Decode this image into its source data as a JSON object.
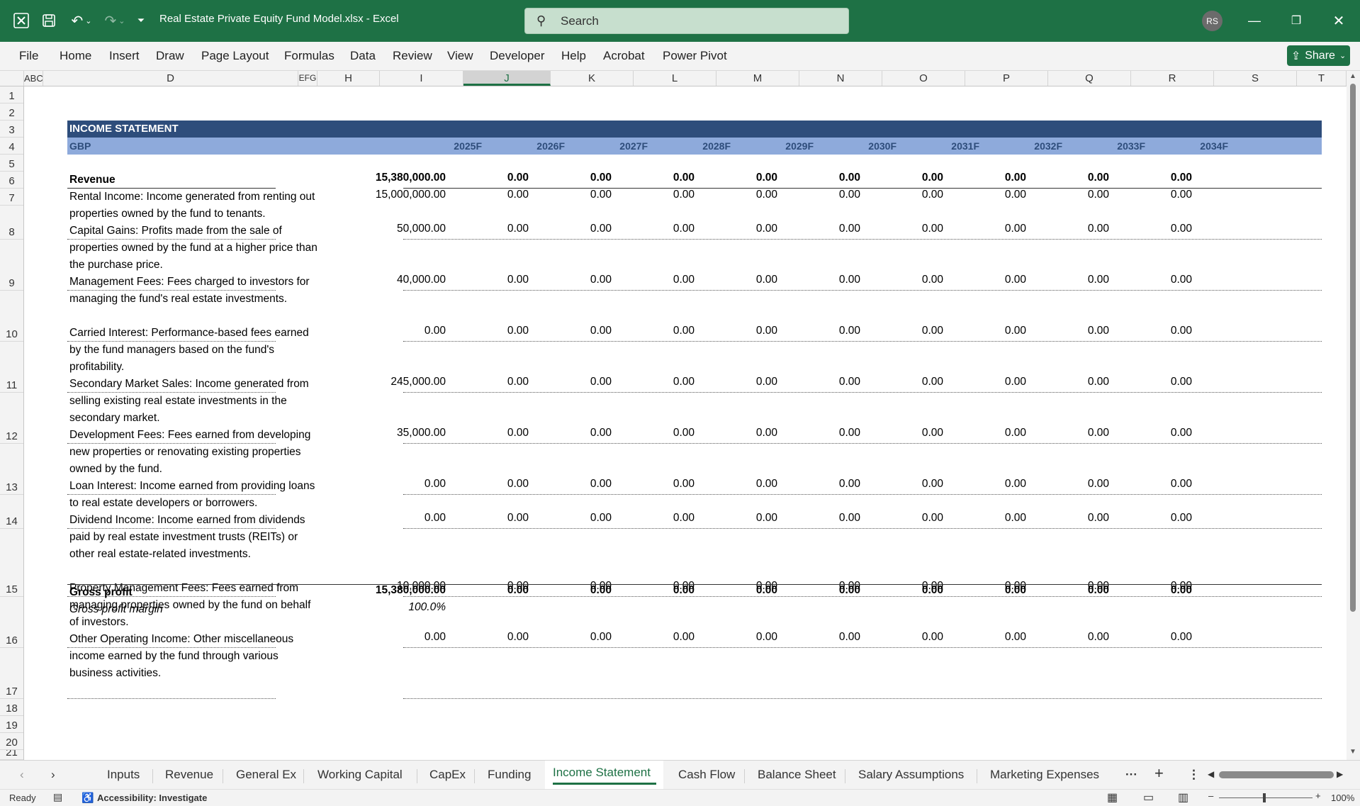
{
  "titlebar": {
    "doc_title": "Real Estate Private Equity Fund Model.xlsx  -  Excel",
    "search_placeholder": "Search",
    "avatar_initials": "RS"
  },
  "menu": [
    "File",
    "Home",
    "Insert",
    "Draw",
    "Page Layout",
    "Formulas",
    "Data",
    "Review",
    "View",
    "Developer",
    "Help",
    "Acrobat",
    "Power Pivot"
  ],
  "share_label": "Share",
  "columns": [
    "ABC",
    "D",
    "EFG",
    "H",
    "I",
    "J",
    "K",
    "L",
    "M",
    "N",
    "O",
    "P",
    "Q",
    "R",
    "S",
    "T"
  ],
  "row_numbers": [
    "1",
    "2",
    "3",
    "4",
    "5",
    "6",
    "7",
    "8",
    "9",
    "10",
    "11",
    "12",
    "13",
    "14",
    "15",
    "16",
    "17",
    "18",
    "19",
    "20",
    "21"
  ],
  "sheet": {
    "title": "INCOME STATEMENT",
    "currency": "GBP",
    "years": [
      "2025F",
      "2026F",
      "2027F",
      "2028F",
      "2029F",
      "2030F",
      "2031F",
      "2032F",
      "2033F",
      "2034F"
    ],
    "revenue_label": "Revenue",
    "revenue_values": [
      "15,380,000.00",
      "0.00",
      "0.00",
      "0.00",
      "0.00",
      "0.00",
      "0.00",
      "0.00",
      "0.00",
      "0.00"
    ],
    "items": [
      {
        "desc": "Rental Income: Income generated from renting out properties owned by the fund to tenants.",
        "values": [
          "15,000,000.00",
          "0.00",
          "0.00",
          "0.00",
          "0.00",
          "0.00",
          "0.00",
          "0.00",
          "0.00",
          "0.00"
        ]
      },
      {
        "desc": "Capital Gains: Profits made from the sale of properties owned by the fund at a higher price than the purchase price.",
        "values": [
          "50,000.00",
          "0.00",
          "0.00",
          "0.00",
          "0.00",
          "0.00",
          "0.00",
          "0.00",
          "0.00",
          "0.00"
        ]
      },
      {
        "desc": "Management Fees: Fees charged to investors for managing the fund's real estate investments.",
        "values": [
          "40,000.00",
          "0.00",
          "0.00",
          "0.00",
          "0.00",
          "0.00",
          "0.00",
          "0.00",
          "0.00",
          "0.00"
        ]
      },
      {
        "desc": "Carried Interest: Performance-based fees earned by the fund managers based on the fund's profitability.",
        "values": [
          "0.00",
          "0.00",
          "0.00",
          "0.00",
          "0.00",
          "0.00",
          "0.00",
          "0.00",
          "0.00",
          "0.00"
        ]
      },
      {
        "desc": "Secondary Market Sales: Income generated from selling existing real estate investments in the secondary market.",
        "values": [
          "245,000.00",
          "0.00",
          "0.00",
          "0.00",
          "0.00",
          "0.00",
          "0.00",
          "0.00",
          "0.00",
          "0.00"
        ]
      },
      {
        "desc": "Development Fees: Fees earned from developing new properties or renovating existing properties owned by the fund.",
        "values": [
          "35,000.00",
          "0.00",
          "0.00",
          "0.00",
          "0.00",
          "0.00",
          "0.00",
          "0.00",
          "0.00",
          "0.00"
        ]
      },
      {
        "desc": "Loan Interest: Income earned from providing loans to real estate developers or borrowers.",
        "values": [
          "0.00",
          "0.00",
          "0.00",
          "0.00",
          "0.00",
          "0.00",
          "0.00",
          "0.00",
          "0.00",
          "0.00"
        ]
      },
      {
        "desc": "Dividend Income: Income earned from dividends paid by real estate investment trusts (REITs) or other real estate-related investments.",
        "values": [
          "0.00",
          "0.00",
          "0.00",
          "0.00",
          "0.00",
          "0.00",
          "0.00",
          "0.00",
          "0.00",
          "0.00"
        ]
      },
      {
        "desc": "Property Management Fees: Fees earned from managing properties owned by the fund on behalf of investors.",
        "values": [
          "10,000.00",
          "0.00",
          "0.00",
          "0.00",
          "0.00",
          "0.00",
          "0.00",
          "0.00",
          "0.00",
          "0.00"
        ]
      },
      {
        "desc": "Other Operating Income: Other miscellaneous income earned by the fund through various business activities.",
        "values": [
          "0.00",
          "0.00",
          "0.00",
          "0.00",
          "0.00",
          "0.00",
          "0.00",
          "0.00",
          "0.00",
          "0.00"
        ]
      }
    ],
    "gross_profit_label": "Gross profit",
    "gross_profit_values": [
      "15,380,000.00",
      "0.00",
      "0.00",
      "0.00",
      "0.00",
      "0.00",
      "0.00",
      "0.00",
      "0.00",
      "0.00"
    ],
    "gross_margin_label": "Gross profit margin",
    "gross_margin_value": "100.0%"
  },
  "tabs": [
    "Inputs",
    "Revenue",
    "General Ex",
    "Working Capital",
    "CapEx",
    "Funding",
    "Income Statement",
    "Cash Flow",
    "Balance Sheet",
    "Salary Assumptions",
    "Marketing Expenses"
  ],
  "active_tab": "Income Statement",
  "status": {
    "ready": "Ready",
    "accessibility": "Accessibility: Investigate",
    "zoom": "100%"
  },
  "colors": {
    "excel_green": "#1e7145",
    "header_dark": "#2e4d7b",
    "header_light": "#8eaadb"
  }
}
